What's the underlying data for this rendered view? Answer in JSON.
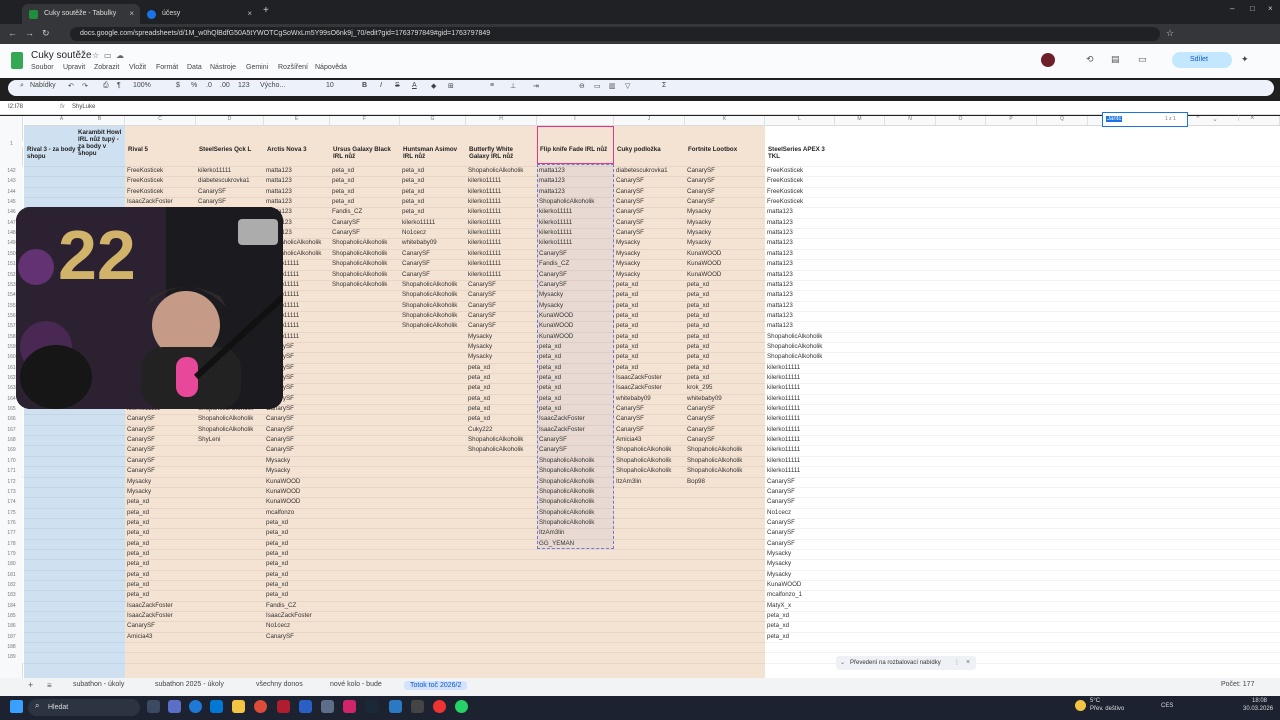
{
  "browser": {
    "tabs": [
      {
        "label": "Cuky soutěže - Tabulky Google",
        "color": "#1e8e3e"
      },
      {
        "label": "účesy",
        "color": "#1a73e8"
      }
    ],
    "url": "docs.google.com/spreadsheets/d/1M_w0hQlBdfG50A5tYWOTCgSoWxLm5Y99sO6nk9j_70/edit?gid=1763797849#gid=1763797849"
  },
  "doc": {
    "title": "Cuky soutěže",
    "menu": [
      "Soubor",
      "Upravit",
      "Zobrazit",
      "Vložit",
      "Formát",
      "Data",
      "Nástroje",
      "Gemini",
      "Rozšíření",
      "Nápověda"
    ],
    "share_label": "Sdílet"
  },
  "toolbar": {
    "search_label": "Nabídky",
    "zoom": "100%",
    "currency": "$",
    "percent": "%",
    "dec1": ".0",
    "dec2": ".00",
    "format123": "123",
    "font": "Výcho...",
    "font_size": "10"
  },
  "formula": {
    "name_box": "I2:I78",
    "fx": "ShyLuke"
  },
  "find": {
    "query": "Jantc",
    "count": "1 z 1"
  },
  "grid": {
    "columns": [
      "A",
      "B",
      "C",
      "D",
      "E",
      "F",
      "G",
      "H",
      "I",
      "J",
      "K",
      "L",
      "M",
      "N",
      "O",
      "P",
      "Q",
      "R"
    ],
    "headers": {
      "A": "Rival 3 - za body v shopu",
      "B": "Karambit Howl IRL nůž tupý - za body v shopu",
      "C": "Rival 5",
      "D": "SteelSeries Qck L",
      "E": "Arctis Nova 3",
      "F": "Ursus Galaxy Black IRL nůž",
      "G": "Huntsman Asimov IRL nůž",
      "H": "Butterfly White Galaxy IRL nůž",
      "I": "Flip knife Fade IRL nůž",
      "J": "Cuky podložka",
      "K": "Fortnite Lootbox",
      "L": "SteelSeries APEX 3 TKL"
    },
    "rownums": [
      "142",
      "143",
      "144",
      "145",
      "146",
      "147",
      "148",
      "149",
      "150",
      "151",
      "152",
      "153",
      "154",
      "155",
      "156",
      "157",
      "158",
      "159",
      "160",
      "161",
      "162",
      "163",
      "164",
      "165",
      "166",
      "167",
      "168",
      "169",
      "170",
      "171",
      "172",
      "173",
      "174",
      "175",
      "176",
      "177",
      "178",
      "179",
      "180",
      "181",
      "182",
      "183",
      "184",
      "185",
      "186",
      "187",
      "188",
      "189"
    ],
    "col_C": [
      "FreeKosticek",
      "FreeKosticek",
      "FreeKosticek",
      "IsaacZackFoster",
      "",
      "",
      "",
      "",
      "",
      "",
      "",
      "",
      "",
      "",
      "",
      "",
      "",
      "",
      "",
      "",
      "",
      "",
      "kilerko11111",
      "kilerko11111",
      "CanarySF",
      "CanarySF",
      "CanarySF",
      "CanarySF",
      "CanarySF",
      "CanarySF",
      "Mysacky",
      "Mysacky",
      "peta_xd",
      "peta_xd",
      "peta_xd",
      "peta_xd",
      "peta_xd",
      "peta_xd",
      "peta_xd",
      "peta_xd",
      "peta_xd",
      "peta_xd",
      "IsaacZackFoster",
      "IsaacZackFoster",
      "CanarySF",
      "Amicia43"
    ],
    "col_D": [
      "kilerko11111",
      "diabetescukrovka1",
      "CanarySF",
      "CanarySF",
      "",
      "",
      "",
      "",
      "",
      "",
      "",
      "",
      "",
      "",
      "",
      "",
      "",
      "",
      "",
      "",
      "",
      "",
      "ShopaholicAlkoholik",
      "ShopaholicAlkoholik",
      "ShopaholicAlkoholik",
      "ShopaholicAlkoholik",
      "ShyLeni",
      "",
      "",
      "",
      "",
      "",
      "",
      "",
      "",
      "",
      "",
      "",
      "",
      "",
      "",
      "",
      "",
      "",
      "",
      ""
    ],
    "col_E": [
      "matta123",
      "matta123",
      "matta123",
      "matta123",
      "matta123",
      "matta123",
      "matta123",
      "ShopaholicAlkoholik",
      "ShopaholicAlkoholik",
      "kilerko11111",
      "kilerko11111",
      "kilerko11111",
      "kilerko11111",
      "kilerko11111",
      "kilerko11111",
      "kilerko11111",
      "kilerko11111",
      "CanarySF",
      "CanarySF",
      "CanarySF",
      "CanarySF",
      "CanarySF",
      "CanarySF",
      "CanarySF",
      "CanarySF",
      "CanarySF",
      "CanarySF",
      "CanarySF",
      "Mysacky",
      "Mysacky",
      "KunaWOOD",
      "KunaWOOD",
      "KunaWOOD",
      "mcalfonzo",
      "peta_xd",
      "peta_xd",
      "peta_xd",
      "peta_xd",
      "peta_xd",
      "peta_xd",
      "peta_xd",
      "peta_xd",
      "Fandis_CZ",
      "IsaacZackFoster",
      "No1cecz",
      "CanarySF"
    ],
    "col_F": [
      "peta_xd",
      "peta_xd",
      "peta_xd",
      "peta_xd",
      "Fandis_CZ",
      "CanarySF",
      "CanarySF",
      "ShopaholicAlkoholik",
      "ShopaholicAlkoholik",
      "ShopaholicAlkoholik",
      "ShopaholicAlkoholik",
      "ShopaholicAlkoholik"
    ],
    "col_G": [
      "peta_xd",
      "peta_xd",
      "peta_xd",
      "peta_xd",
      "peta_xd",
      "kilerko11111",
      "No1cecz",
      "whitebaby09",
      "CanarySF",
      "CanarySF",
      "CanarySF",
      "ShopaholicAlkoholik",
      "ShopaholicAlkoholik",
      "ShopaholicAlkoholik",
      "ShopaholicAlkoholik",
      "ShopaholicAlkoholik"
    ],
    "col_H": [
      "ShopaholicAlkoholik",
      "kilerko11111",
      "kilerko11111",
      "kilerko11111",
      "kilerko11111",
      "kilerko11111",
      "kilerko11111",
      "kilerko11111",
      "kilerko11111",
      "kilerko11111",
      "kilerko11111",
      "CanarySF",
      "CanarySF",
      "CanarySF",
      "CanarySF",
      "CanarySF",
      "Mysacky",
      "Mysacky",
      "Mysacky",
      "peta_xd",
      "peta_xd",
      "peta_xd",
      "peta_xd",
      "peta_xd",
      "peta_xd",
      "Cuky222",
      "ShopaholicAlkoholik",
      "ShopaholicAlkoholik"
    ],
    "col_I": [
      "matta123",
      "matta123",
      "matta123",
      "ShopaholicAlkoholik",
      "kilerko11111",
      "kilerko11111",
      "kilerko11111",
      "kilerko11111",
      "CanarySF",
      "Fandis_CZ",
      "CanarySF",
      "CanarySF",
      "Mysacky",
      "Mysacky",
      "KunaWOOD",
      "KunaWOOD",
      "KunaWOOD",
      "peta_xd",
      "peta_xd",
      "peta_xd",
      "peta_xd",
      "peta_xd",
      "peta_xd",
      "peta_xd",
      "IsaacZackFoster",
      "IsaacZackFoster",
      "CanarySF",
      "CanarySF",
      "ShopaholicAlkoholik",
      "ShopaholicAlkoholik",
      "ShopaholicAlkoholik",
      "ShopaholicAlkoholik",
      "ShopaholicAlkoholik",
      "ShopaholicAlkoholik",
      "ShopaholicAlkoholik",
      "ItzAm3lin",
      "GG_YEMAN"
    ],
    "col_J": [
      "diabetescukrovka1",
      "CanarySF",
      "CanarySF",
      "CanarySF",
      "CanarySF",
      "CanarySF",
      "CanarySF",
      "Mysacky",
      "Mysacky",
      "Mysacky",
      "Mysacky",
      "peta_xd",
      "peta_xd",
      "peta_xd",
      "peta_xd",
      "peta_xd",
      "peta_xd",
      "peta_xd",
      "peta_xd",
      "peta_xd",
      "IsaacZackFoster",
      "IsaacZackFoster",
      "whitebaby09",
      "CanarySF",
      "CanarySF",
      "CanarySF",
      "Amicia43",
      "ShopaholicAlkoholik",
      "ShopaholicAlkoholik",
      "ShopaholicAlkoholik",
      "ItzAm3lin"
    ],
    "col_K": [
      "CanarySF",
      "CanarySF",
      "CanarySF",
      "CanarySF",
      "Mysacky",
      "Mysacky",
      "Mysacky",
      "Mysacky",
      "KunaWOOD",
      "KunaWOOD",
      "KunaWOOD",
      "peta_xd",
      "peta_xd",
      "peta_xd",
      "peta_xd",
      "peta_xd",
      "peta_xd",
      "peta_xd",
      "peta_xd",
      "peta_xd",
      "peta_xd",
      "krok_295",
      "whitebaby09",
      "CanarySF",
      "CanarySF",
      "CanarySF",
      "CanarySF",
      "ShopaholicAlkoholik",
      "ShopaholicAlkoholik",
      "ShopaholicAlkoholik",
      "Bop98"
    ],
    "col_L": [
      "FreeKosticek",
      "FreeKosticek",
      "FreeKosticek",
      "FreeKosticek",
      "matta123",
      "matta123",
      "matta123",
      "matta123",
      "matta123",
      "matta123",
      "matta123",
      "matta123",
      "matta123",
      "matta123",
      "matta123",
      "matta123",
      "ShopaholicAlkoholik",
      "ShopaholicAlkoholik",
      "ShopaholicAlkoholik",
      "kilerko11111",
      "kilerko11111",
      "kilerko11111",
      "kilerko11111",
      "kilerko11111",
      "kilerko11111",
      "kilerko11111",
      "kilerko11111",
      "kilerko11111",
      "kilerko11111",
      "kilerko11111",
      "CanarySF",
      "CanarySF",
      "CanarySF",
      "No1cecz",
      "CanarySF",
      "CanarySF",
      "CanarySF",
      "Mysacky",
      "Mysacky",
      "Mysacky",
      "KunaWOOD",
      "mcalfonzo_1",
      "MatyX_x",
      "peta_xd",
      "peta_xd",
      "peta_xd"
    ]
  },
  "snackbar": "Převedení na rozbalovací nabídky",
  "sheet_tabs": [
    "subathon - úkoly",
    "subathon 2025 - úkoly",
    "všechny donos",
    "nové kolo - bude",
    "Totok toč 2026/2"
  ],
  "sheet_count": "Počet: 177",
  "taskbar": {
    "search": "Hledat",
    "weather": "5°C",
    "weather_desc": "Přev. deštivo",
    "lang": "CES",
    "time": "18:08",
    "date": "30.03.2026"
  },
  "colors": {
    "tan": "#f4e2d2",
    "blue": "#cfe0f1",
    "select": "#e8378a",
    "sheets_green": "#34a853"
  }
}
